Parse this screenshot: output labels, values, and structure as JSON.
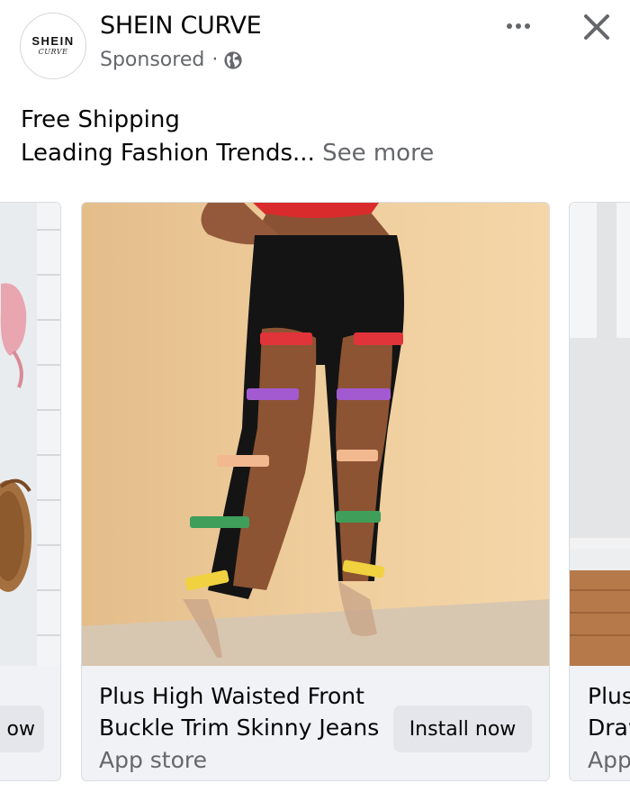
{
  "header": {
    "avatar_brand": "SHEIN",
    "avatar_sub": "CURVE",
    "page_name": "SHEIN CURVE",
    "sponsored": "Sponsored",
    "separator": "·",
    "privacy_icon": "globe-icon",
    "more_icon": "more-options-icon",
    "close_icon": "close-icon"
  },
  "ad_text": {
    "line1": "Free Shipping",
    "line2": "Leading Fashion Trends...",
    "see_more": "See more"
  },
  "carousel": {
    "left_card": {
      "button_partial": "ow"
    },
    "main_card": {
      "title_line1": "Plus High Waisted Front",
      "title_line2": "Buckle Trim Skinny Jeans",
      "store": "App store",
      "button": "Install now"
    },
    "right_card": {
      "title_line1": "Plus",
      "title_line2": "Draw",
      "store": "App"
    }
  },
  "colors": {
    "text_primary": "#050505",
    "text_secondary": "#65676b",
    "card_bg": "#f0f2f5",
    "button_bg": "#e4e6eb"
  }
}
